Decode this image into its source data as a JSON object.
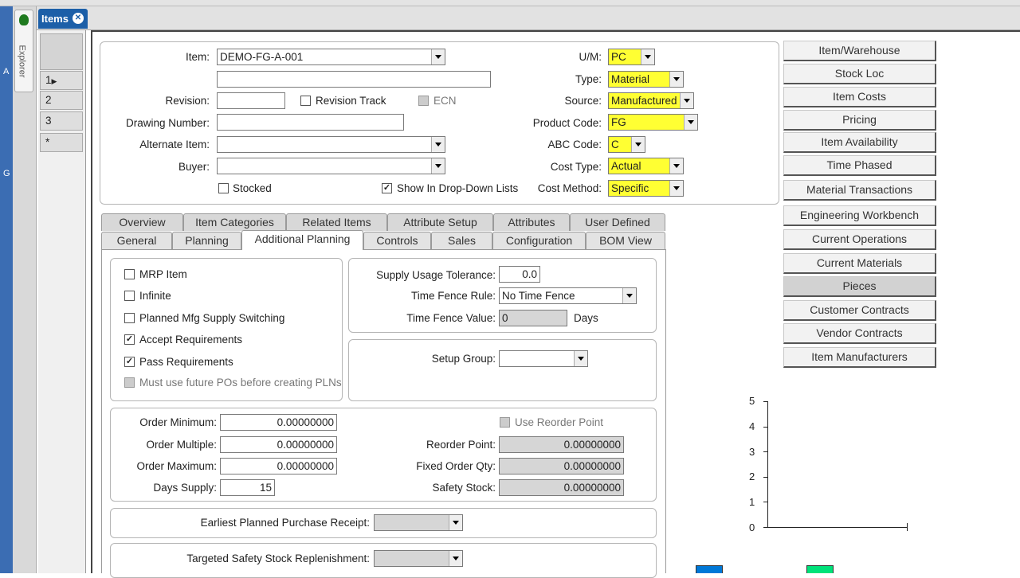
{
  "tab": {
    "label": "Items"
  },
  "explorer_label": "Explorer",
  "left_letters": {
    "a": "A",
    "g": "G"
  },
  "rows": [
    "1",
    "2",
    "3",
    "*"
  ],
  "header": {
    "item_label": "Item:",
    "item_value": "DEMO-FG-A-001",
    "revision_label": "Revision:",
    "revision_track": "Revision Track",
    "ecn": "ECN",
    "drawing_label": "Drawing Number:",
    "alternate_label": "Alternate Item:",
    "buyer_label": "Buyer:",
    "stocked": "Stocked",
    "show_dropdown": "Show In Drop-Down Lists",
    "um_label": "U/M:",
    "um_value": "PC",
    "type_label": "Type:",
    "type_value": "Material",
    "source_label": "Source:",
    "source_value": "Manufactured",
    "product_label": "Product Code:",
    "product_value": "FG",
    "abc_label": "ABC Code:",
    "abc_value": "C",
    "cost_type_label": "Cost Type:",
    "cost_type_value": "Actual",
    "cost_method_label": "Cost Method:",
    "cost_method_value": "Specific"
  },
  "tabs_row1": [
    "Overview",
    "Item Categories",
    "Related Items",
    "Attribute Setup",
    "Attributes",
    "User Defined"
  ],
  "tabs_row2": [
    "General",
    "Planning",
    "Additional Planning",
    "Controls",
    "Sales",
    "Configuration",
    "BOM View"
  ],
  "planning": {
    "mrp_item": "MRP Item",
    "infinite": "Infinite",
    "planned_switch": "Planned Mfg Supply Switching",
    "accept_req": "Accept Requirements",
    "pass_req": "Pass Requirements",
    "must_use": "Must use future POs before creating PLNs",
    "supply_tol_label": "Supply Usage Tolerance:",
    "supply_tol_value": "0.0",
    "tf_rule_label": "Time Fence Rule:",
    "tf_rule_value": "No Time Fence",
    "tf_value_label": "Time Fence Value:",
    "tf_value": "0",
    "tf_days": "Days",
    "setup_group_label": "Setup Group:",
    "order_min_label": "Order Minimum:",
    "order_min": "0.00000000",
    "order_mult_label": "Order Multiple:",
    "order_mult": "0.00000000",
    "order_max_label": "Order Maximum:",
    "order_max": "0.00000000",
    "days_supply_label": "Days Supply:",
    "days_supply": "15",
    "use_reorder": "Use Reorder Point",
    "reorder_label": "Reorder Point:",
    "reorder": "0.00000000",
    "fixed_label": "Fixed Order Qty:",
    "fixed": "0.00000000",
    "safety_label": "Safety Stock:",
    "safety": "0.00000000",
    "earliest_label": "Earliest Planned Purchase Receipt:",
    "targeted_label": "Targeted Safety Stock Replenishment:"
  },
  "side_buttons": [
    "Item/Warehouse",
    "Stock Loc",
    "Item Costs",
    "Pricing",
    "Item Availability",
    "Time Phased",
    "Material Transactions",
    "Engineering Workbench",
    "Current Operations",
    "Current Materials",
    "Pieces",
    "Customer Contracts",
    "Vendor Contracts",
    "Item Manufacturers"
  ],
  "chart_data": {
    "type": "bar",
    "categories": [],
    "series": [],
    "yticks": [
      "0",
      "1",
      "2",
      "3",
      "4",
      "5"
    ],
    "ylim": [
      0,
      5
    ],
    "legend_colors": [
      "#0078d7",
      "#00e27a"
    ]
  },
  "colors": {
    "required": "#ffff33",
    "title_blue": "#1c5fa8"
  }
}
